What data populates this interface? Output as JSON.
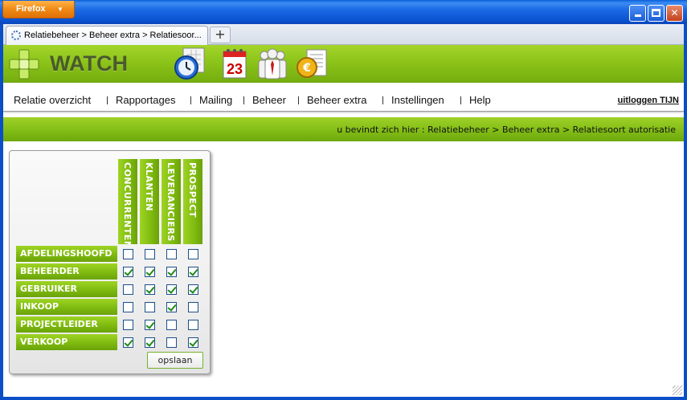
{
  "browser": {
    "menu_button": "Firefox",
    "tab_title": "Relatiebeheer > Beheer extra > Relatiesoor...",
    "new_tab": "+"
  },
  "app": {
    "logo_text": "WATCH",
    "header_icons": [
      "clock-icon",
      "calendar-icon",
      "people-icon",
      "finance-icon"
    ],
    "calendar_day": "23",
    "accent_color": "#8cc41a"
  },
  "menu": {
    "items": [
      {
        "label": "Relatie overzicht"
      },
      {
        "label": "Rapportages"
      },
      {
        "label": "Mailing"
      },
      {
        "label": "Beheer"
      },
      {
        "label": "Beheer extra"
      },
      {
        "label": "Instellingen"
      },
      {
        "label": "Help"
      }
    ],
    "logout": "uitloggen TIJN"
  },
  "breadcrumb": "u bevindt zich hier : Relatiebeheer > Beheer extra > Relatiesoort autorisatie",
  "matrix": {
    "columns": [
      "CONCURRENTEN",
      "KLANTEN",
      "LEVERANCIERS",
      "PROSPECT"
    ],
    "rows": [
      {
        "label": "AFDELINGSHOOFD",
        "checks": [
          false,
          false,
          false,
          false
        ]
      },
      {
        "label": "BEHEERDER",
        "checks": [
          true,
          true,
          true,
          true
        ]
      },
      {
        "label": "GEBRUIKER",
        "checks": [
          false,
          true,
          true,
          true
        ]
      },
      {
        "label": "INKOOP",
        "checks": [
          false,
          false,
          true,
          false
        ]
      },
      {
        "label": "PROJECTLEIDER",
        "checks": [
          false,
          true,
          false,
          false
        ]
      },
      {
        "label": "VERKOOP",
        "checks": [
          true,
          true,
          false,
          true
        ]
      }
    ],
    "save_label": "opslaan"
  }
}
